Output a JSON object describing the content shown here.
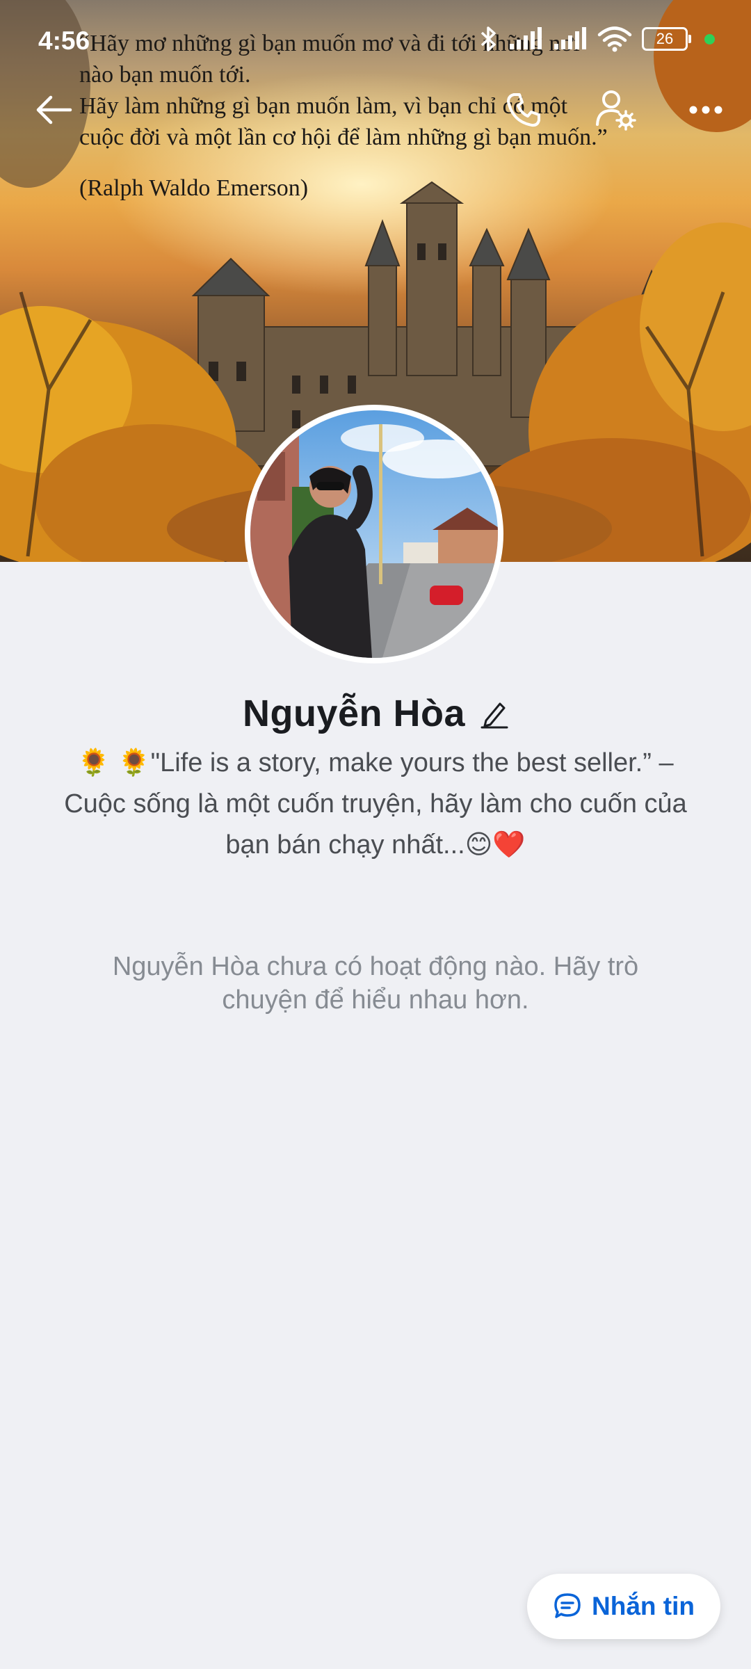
{
  "status_bar": {
    "time": "4:56",
    "battery": "26",
    "icons": [
      "bluetooth-icon",
      "signal-icon",
      "signal-icon",
      "wifi-icon",
      "battery-icon"
    ]
  },
  "cover": {
    "quote_lines": [
      "“Hãy mơ những gì bạn muốn mơ và đi tới những nơi",
      "nào bạn muốn tới.",
      "Hãy làm những gì bạn muốn làm, vì bạn chỉ có một",
      "cuộc đời và một lần cơ hội để làm những gì bạn muốn.”"
    ],
    "quote_author": "(Ralph Waldo Emerson)"
  },
  "topbar": {
    "icons": [
      "back-arrow-icon",
      "phone-icon",
      "user-settings-icon",
      "more-icon"
    ]
  },
  "profile": {
    "name": "Nguyễn Hòa",
    "bio_line1": "🌻 🌻\"Life is a story, make yours the best seller.” –",
    "bio_line2": "Cuộc sống là một cuốn truyện, hãy làm cho cuốn của",
    "bio_line3": "bạn bán chạy nhất...😊❤️",
    "empty_activity_line1": "Nguyễn Hòa chưa có hoạt động nào. Hãy trò",
    "empty_activity_line2": "chuyện để hiểu nhau hơn."
  },
  "actions": {
    "message_label": "Nhắn tin"
  },
  "colors": {
    "accent": "#0a64d8",
    "background": "#eff0f4",
    "status_dot": "#2ed158"
  }
}
